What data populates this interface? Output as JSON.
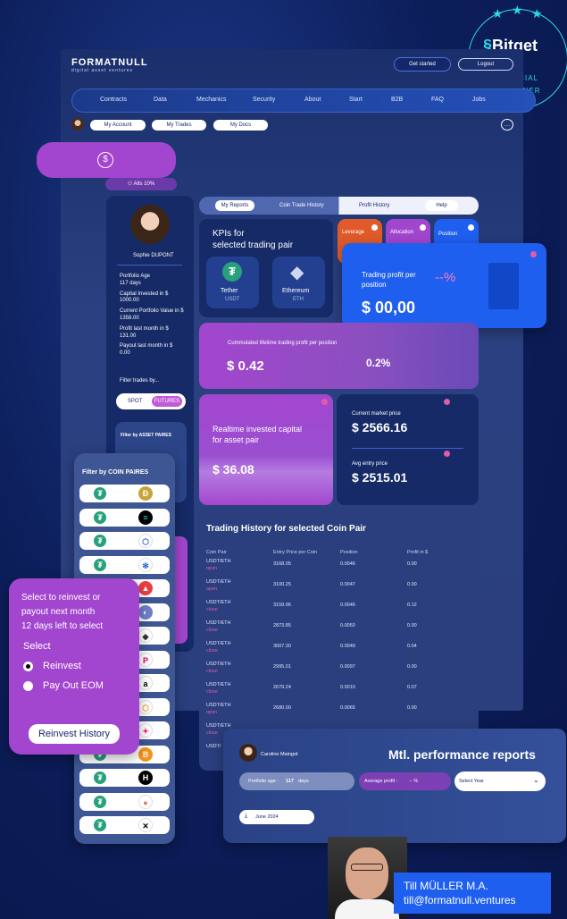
{
  "brand": {
    "name": "FORMATNULL",
    "tagline": "digital asset ventures"
  },
  "partner": {
    "name": "Bitget",
    "line1": "OFFICIAL",
    "line2": "PARTNER"
  },
  "header": {
    "get_started": "Get started",
    "logout": "Logout"
  },
  "nav": [
    "Contracts",
    "Data",
    "Mechanics",
    "Security",
    "About",
    "Start",
    "B2B",
    "FAQ",
    "Jobs"
  ],
  "account_tabs": [
    "My Account",
    "My Trades",
    "My Docs"
  ],
  "alts_badge": "Alts 10%",
  "report_tabs": [
    "My Reports",
    "Coin Trade History",
    "Profit History",
    "Help"
  ],
  "profile": {
    "name": "Sophie DUPONT",
    "portfolio_age_label": "Portfolio Age",
    "portfolio_age": "117 days",
    "capital_label": "Capital Invested in $",
    "capital": "1000.00",
    "current_value_label": "Current Portfolio Value in $",
    "current_value": "1358.00",
    "profit_last_label": "Profit last month in $",
    "profit_last": "131.00",
    "payout_label": "Payout last month in $",
    "payout": "0.00",
    "filter_label": "Filter trades by...",
    "spot": "SPOT",
    "futures": "FUTURES",
    "asset_filter_title": "Filter by ASSET PAIRES"
  },
  "kpi": {
    "title_line1": "KPIs for",
    "title_line2": "selected trading pair",
    "coin1_name": "Tether",
    "coin1_ticker": "USDT",
    "coin2_name": "Ethereum",
    "coin2_ticker": "ETH",
    "leverage": "Leverage",
    "allocation": "Allocation",
    "position": "Position"
  },
  "trading_profit": {
    "line1": "Trading profit per",
    "line2": "position",
    "value": "$ 00,00",
    "pct": "--%"
  },
  "cumulated": {
    "label": "Cummulated lifetime trading profit per position",
    "value": "$ 0.42",
    "pct": "0.2%"
  },
  "realtime": {
    "line1": "Realtime invested capital",
    "line2": "for asset pair",
    "value": "$ 36.08"
  },
  "market": {
    "current_label": "Current market price",
    "current": "$ 2566.16",
    "avg_label": "Avg entry price",
    "avg": "$ 2515.01"
  },
  "history": {
    "title": "Trading History for  selected Coin Pair",
    "columns": [
      "Coin Pair",
      "Entry Price per Coin",
      "Position",
      "Profit in $"
    ],
    "rows": [
      {
        "pair": "USDT/ETH",
        "status": "open",
        "entry": "3168.05",
        "position": "0.0046",
        "profit": "0.00"
      },
      {
        "pair": "USDT/ETH",
        "status": "open",
        "entry": "3100.25",
        "position": "0.0047",
        "profit": "0.00"
      },
      {
        "pair": "USDT/ETH",
        "status": "close",
        "entry": "3159.96",
        "position": "0.0046",
        "profit": "0.12"
      },
      {
        "pair": "USDT/ETH",
        "status": "close",
        "entry": "2873.85",
        "position": "0.0050",
        "profit": "0.00"
      },
      {
        "pair": "USDT/ETH",
        "status": "close",
        "entry": "3007.30",
        "position": "0.0049",
        "profit": "0.04"
      },
      {
        "pair": "USDT/ETH",
        "status": "close",
        "entry": "2995.01",
        "position": "0.0097",
        "profit": "0.00"
      },
      {
        "pair": "USDT/ETH",
        "status": "close",
        "entry": "2679.24",
        "position": "0.0010",
        "profit": "0.07"
      },
      {
        "pair": "USDT/ETH",
        "status": "open",
        "entry": "2680.00",
        "position": "0.0065",
        "profit": "0.00"
      },
      {
        "pair": "USDT/ETH",
        "status": "close",
        "entry": "",
        "position": "",
        "profit": ""
      },
      {
        "pair": "USDT/",
        "status": "",
        "entry": "",
        "position": "",
        "profit": ""
      }
    ]
  },
  "coin_filter": {
    "title": "Filter by COIN PAIRES",
    "coins": [
      {
        "sym": "Ð",
        "bg": "#c9a43a",
        "fg": "#fff"
      },
      {
        "sym": "≡",
        "bg": "#000000",
        "fg": "#22d3c5"
      },
      {
        "sym": "⬡",
        "bg": "#ffffff",
        "fg": "#2b5fe0"
      },
      {
        "sym": "✻",
        "bg": "#ffffff",
        "fg": "#2a6fd6"
      },
      {
        "sym": "▲",
        "bg": "#e84142",
        "fg": "#fff"
      },
      {
        "sym": "◐",
        "bg": "#6e7fc9",
        "fg": "#fff"
      },
      {
        "sym": "◆",
        "bg": "#ffffff",
        "fg": "#333"
      },
      {
        "sym": "P",
        "bg": "#ffffff",
        "fg": "#e6007a"
      },
      {
        "sym": "a",
        "bg": "#ffffff",
        "fg": "#000"
      },
      {
        "sym": "⬡",
        "bg": "#ffffff",
        "fg": "#f5a623"
      },
      {
        "sym": "✦",
        "bg": "#ffffff",
        "fg": "#ff2d78"
      },
      {
        "sym": "B",
        "bg": "#f7931a",
        "fg": "#fff"
      },
      {
        "sym": "H",
        "bg": "#000000",
        "fg": "#fff"
      },
      {
        "sym": "●",
        "bg": "#ffffff",
        "fg": "#f07060"
      },
      {
        "sym": "✕",
        "bg": "#ffffff",
        "fg": "#000"
      }
    ]
  },
  "reinvest": {
    "line1": "Select to reinvest or",
    "line2": "payout next month",
    "line3": "12 days left to select",
    "select_label": "Select",
    "option1": "Reinvest",
    "option2": "Pay Out EOM",
    "history_button": "Reinvest History"
  },
  "monthly": {
    "user": "Caroline Maingot",
    "title": "Mtl. performance reports",
    "portfolio_age_label": "Portfolio age :",
    "portfolio_age_value": "117",
    "portfolio_age_unit": "days",
    "avg_profit_label": "Average profit :",
    "avg_profit_value": "-- %",
    "select_year": "Select Year",
    "download": "June 2024"
  },
  "contact": {
    "name": "Till MÜLLER M.A.",
    "email": "till@formatnull.ventures"
  },
  "colors": {
    "purple": "#a346cf",
    "blue": "#1f5ff0",
    "navy": "#0b1a4e",
    "pink": "#e05ca8"
  }
}
